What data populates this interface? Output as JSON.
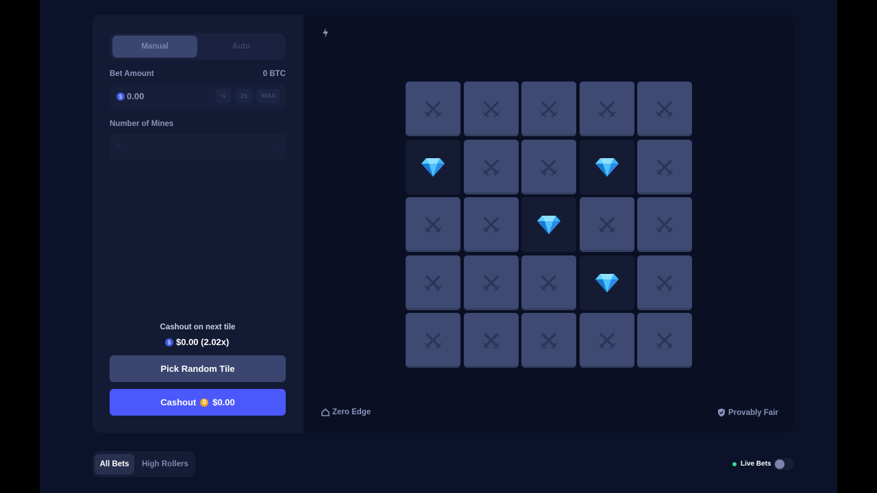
{
  "tabs": {
    "manual": "Manual",
    "auto": "Auto"
  },
  "bet": {
    "label": "Bet Amount",
    "balance": "0 BTC",
    "currency_icon": "$",
    "value": "0.00",
    "half": "½",
    "double": "2x",
    "max": "MAX"
  },
  "mines": {
    "label": "Number of Mines",
    "value": "3"
  },
  "cashout_next": {
    "label": "Cashout on next tile",
    "icon": "$",
    "value": "$0.00 (2.02x)"
  },
  "buttons": {
    "random_tile": "Pick Random Tile",
    "cashout": "Cashout",
    "cashout_coin_icon": "₿",
    "cashout_amount": "$0.00"
  },
  "board": {
    "rows": 5,
    "cols": 5,
    "gems": [
      [
        1,
        0
      ],
      [
        1,
        3
      ],
      [
        2,
        2
      ],
      [
        3,
        3
      ]
    ]
  },
  "footer": {
    "zero_edge": "Zero Edge",
    "provably_fair": "Provably Fair"
  },
  "bets_tabs": {
    "all": "All Bets",
    "high": "High Rollers"
  },
  "live_bets": {
    "label": "Live Bets",
    "enabled": false
  },
  "colors": {
    "accent": "#4b59fc",
    "tile": "#3e4a72",
    "revealed_tile": "#141b33",
    "live_dot": "#37d99a"
  }
}
